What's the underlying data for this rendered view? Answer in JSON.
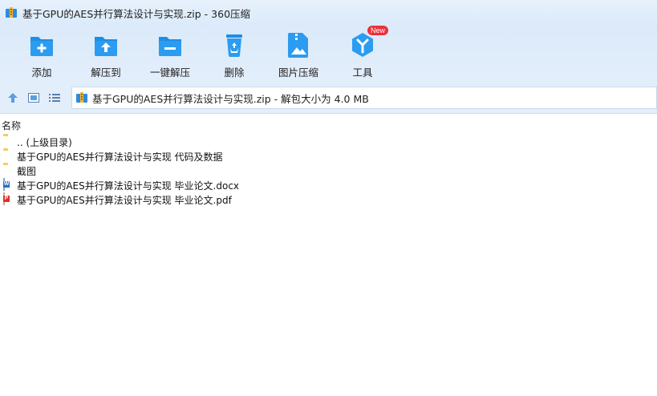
{
  "window": {
    "title": "基于GPU的AES并行算法设计与实现.zip - 360压缩"
  },
  "toolbar": {
    "items": [
      {
        "label": "添加",
        "icon": "add-folder-icon"
      },
      {
        "label": "解压到",
        "icon": "extract-to-icon"
      },
      {
        "label": "一键解压",
        "icon": "one-click-extract-icon"
      },
      {
        "label": "删除",
        "icon": "recycle-bin-icon"
      },
      {
        "label": "图片压缩",
        "icon": "image-compress-icon"
      },
      {
        "label": "工具",
        "icon": "tools-icon",
        "badge": "New"
      }
    ]
  },
  "addressbar": {
    "path": "基于GPU的AES并行算法设计与实现.zip - 解包大小为 4.0 MB"
  },
  "list": {
    "header_name": "名称",
    "items": [
      {
        "name": ".. (上级目录)",
        "type": "folder"
      },
      {
        "name": "基于GPU的AES并行算法设计与实现 代码及数据",
        "type": "folder"
      },
      {
        "name": "截图",
        "type": "folder"
      },
      {
        "name": "基于GPU的AES并行算法设计与实现 毕业论文.docx",
        "type": "docx"
      },
      {
        "name": "基于GPU的AES并行算法设计与实现 毕业论文.pdf",
        "type": "pdf"
      }
    ]
  },
  "colors": {
    "accent": "#1e8ee6",
    "folder": "#f6cd5b",
    "badge": "#e8323a",
    "docx": "#2b6cc4",
    "pdf": "#d9312b"
  }
}
